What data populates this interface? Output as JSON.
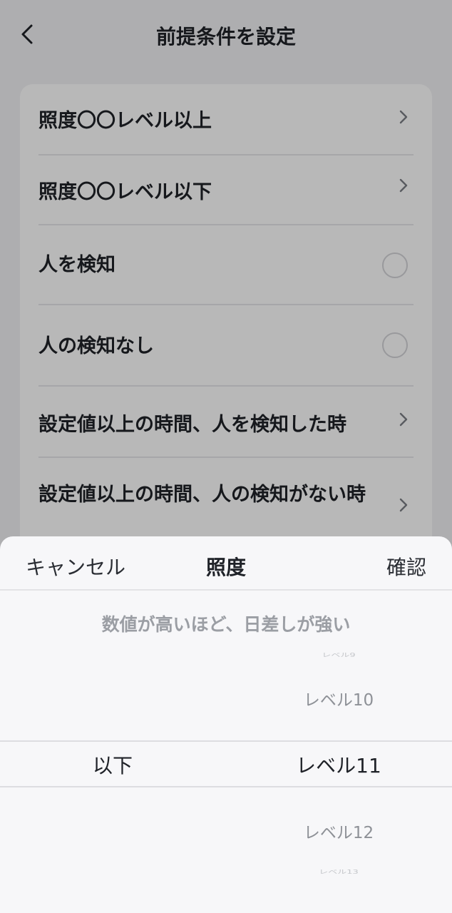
{
  "header": {
    "title": "前提条件を設定"
  },
  "conditions": [
    {
      "label": "照度〇〇レベル以上",
      "control": "chevron"
    },
    {
      "label": "照度〇〇レベル以下",
      "control": "chevron"
    },
    {
      "label": "人を検知",
      "control": "radio"
    },
    {
      "label": "人の検知なし",
      "control": "radio"
    },
    {
      "label": "設定値以上の時間、人を検知した時",
      "control": "chevron"
    },
    {
      "label": "設定値以上の時間、人の検知がない時",
      "control": "chevron"
    }
  ],
  "sheet": {
    "cancel_label": "キャンセル",
    "title": "照度",
    "confirm_label": "確認",
    "hint": "数値が高いほど、日差しが強い",
    "comparison_selected": "以下",
    "levels": [
      "レベル9",
      "レベル10",
      "レベル11",
      "レベル12",
      "レベル13"
    ],
    "level_selected": "レベル11"
  },
  "colors": {
    "overlay": "rgba(0,0,0,0.28)",
    "divider": "#e6e7ea",
    "text": "#1f2228",
    "muted": "#9b9ea4"
  }
}
